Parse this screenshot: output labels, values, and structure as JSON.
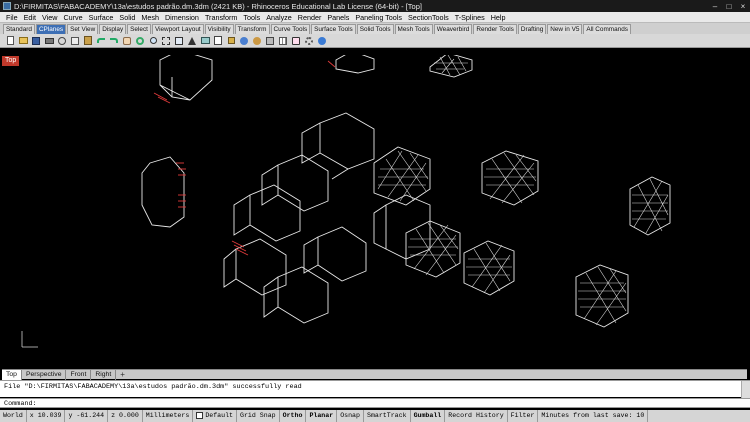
{
  "titlebar": {
    "title": "D:\\FIRMITAS\\FABACADEMY\\13a\\estudos padrão.dm.3dm (2421 KB) - Rhinoceros Educational Lab License (64-bit) - [Top]",
    "minimize": "–",
    "maximize": "□",
    "close": "×"
  },
  "menubar": {
    "items": [
      "File",
      "Edit",
      "View",
      "Curve",
      "Surface",
      "Solid",
      "Mesh",
      "Dimension",
      "Transform",
      "Tools",
      "Analyze",
      "Render",
      "Panels",
      "Paneling Tools",
      "SectionTools",
      "T-Splines",
      "Help"
    ]
  },
  "tabs": {
    "items": [
      "Standard",
      "CPlanes",
      "Set View",
      "Display",
      "Select",
      "Viewport Layout",
      "Visibility",
      "Transform",
      "Curve Tools",
      "Surface Tools",
      "Solid Tools",
      "Mesh Tools",
      "Weaverbird",
      "Render Tools",
      "Drafting",
      "New in V5",
      "All Commands"
    ],
    "active": "CPlanes"
  },
  "viewport": {
    "label": "Top"
  },
  "viewtabs": {
    "items": [
      "Top",
      "Perspective",
      "Front",
      "Right"
    ],
    "active": "Top",
    "add": "+"
  },
  "history": {
    "line": "File \"D:\\FIRMITAS\\FABACADEMY\\13a\\estudos padrão.dm.3dm\" successfully read"
  },
  "command": {
    "prompt": "Command:"
  },
  "status": {
    "cplane": "World",
    "x": "x 10.039",
    "y": "y -61.244",
    "z": "z 0.000",
    "units": "Millimeters",
    "layer": "Default",
    "toggles": [
      "Grid Snap",
      "Ortho",
      "Planar",
      "Osnap",
      "SmartTrack",
      "Gumball",
      "Record History",
      "Filter"
    ],
    "active_toggles": [
      "Ortho",
      "Planar",
      "Gumball"
    ],
    "autosave": "Minutes from last save: 10"
  },
  "colors": {
    "viewport_bg": "#000000",
    "label_red": "#c0392b",
    "active_tab": "#3d6fb5",
    "wire": "#e8e8e8",
    "red_marks": "#e23b3b"
  }
}
